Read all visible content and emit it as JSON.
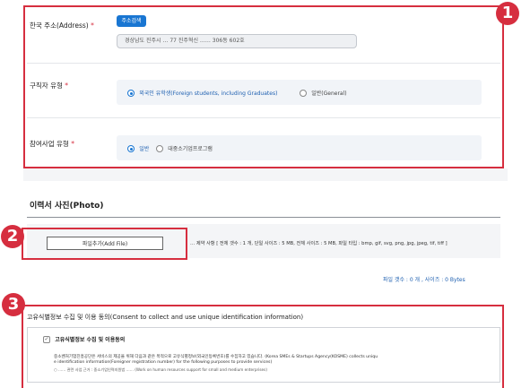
{
  "badges": [
    "1",
    "2",
    "3"
  ],
  "address": {
    "label": "한국 주소(Address)",
    "required_mark": "*",
    "search_button": "주소검색",
    "value": "경상남도 진주시 … 77 진주혁신 …… 306동 602호"
  },
  "job_seeker_type": {
    "label": "구직자 유형",
    "required_mark": "*",
    "options": [
      {
        "label": "외국인 유학생(Foreign students, including Graduates)",
        "selected": true
      },
      {
        "label": "일반(General)",
        "selected": false
      }
    ]
  },
  "program_type": {
    "label": "참여사업 유형",
    "required_mark": "*",
    "options": [
      {
        "label": "일반",
        "selected": true
      },
      {
        "label": "대중소기업프로그램",
        "selected": false
      }
    ]
  },
  "photo": {
    "title": "이력서 사진(Photo)",
    "add_file_button": "파일추가(Add File)",
    "constraints": "… 제약 사항 [ 전체 갯수 : 1 개, 단일 사이즈 : 5 MB, 전체 사이즈 : 5 MB, 파일 타입 : bmp, gif, svg, png, jpg, jpeg, tif, tiff ]",
    "file_count": "파일 갯수 : 0 개 , 사이즈 : 0 Bytes"
  },
  "consent": {
    "title": "고유식별정보 수집 및 이용 동의(Consent to collect and use unique identification information)",
    "checkbox_label": "고유식별정보 수집 및 이용동의",
    "body_line1": "중소벤처기업진흥공단은 서비스의 제공을 위해 다음과 같은 목적으로 고유식별정보(외국인등록번호)를 수집하고 있습니다. (Korea SMEs & Startups Agency(KOSME) collects uniqu",
    "body_line2": "e identification information(Foreigner registration number) for the following purposes to provide services)",
    "body_line3": "○ …… 관련 사업 근거 : 중소기업인력지원법 …… (Work on human resources support for small and medium enterprises)"
  },
  "colors": {
    "accent": "#1976d2",
    "highlight": "#d62e3f"
  }
}
